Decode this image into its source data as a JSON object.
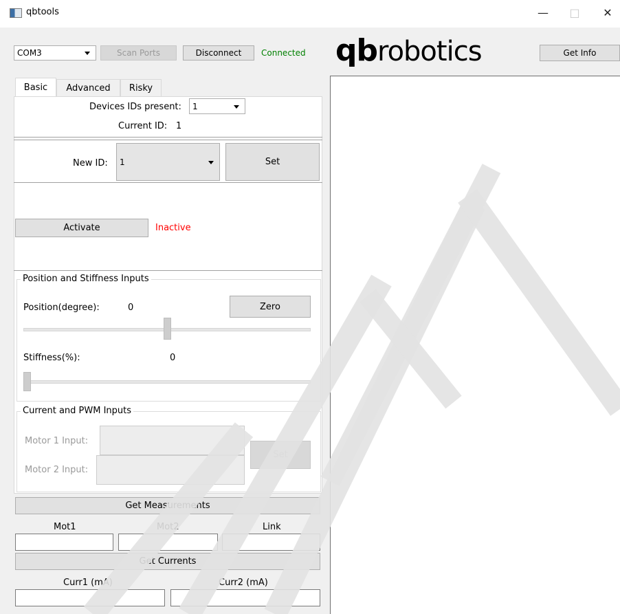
{
  "window": {
    "title": "qbtools",
    "min_glyph": "—",
    "max_glyph": "□",
    "close_glyph": "✕"
  },
  "connection": {
    "port_value": "COM3",
    "scan_label": "Scan Ports",
    "disconnect_label": "Disconnect",
    "status": "Connected",
    "status_color": "#008000"
  },
  "brand": {
    "qb": "qb",
    "rest": "robotics"
  },
  "get_info_label": "Get Info",
  "tabs": [
    {
      "label": "Basic"
    },
    {
      "label": "Advanced"
    },
    {
      "label": "Risky"
    }
  ],
  "devices": {
    "label": "Devices IDs present:",
    "value": "1"
  },
  "current_id": {
    "label": "Current ID:",
    "value": "1"
  },
  "new_id": {
    "label": "New ID:",
    "value": "1",
    "set_label": "Set"
  },
  "activate": {
    "label": "Activate",
    "status": "Inactive",
    "status_color": "#ff0000"
  },
  "pos_stiff": {
    "title": "Position and Stiffness Inputs",
    "position_label": "Position(degree):",
    "position_value": "0",
    "zero_label": "Zero",
    "stiffness_label": "Stiffness(%):",
    "stiffness_value": "0",
    "position_slider_fraction": 0.5,
    "stiffness_slider_fraction": 0.0
  },
  "current_pwm": {
    "title": "Current and PWM Inputs",
    "motor1_label": "Motor 1 Input:",
    "motor2_label": "Motor 2 Input:",
    "set_label": "Set"
  },
  "measurements": {
    "button": "Get Measurements",
    "col1": "Mot1",
    "col2": "Mot2",
    "col3": "Link"
  },
  "currents": {
    "button": "Get Currents",
    "col1": "Curr1 (mA)",
    "col2": "Curr2 (mA)"
  },
  "watermark_color": "#e2e2e2"
}
